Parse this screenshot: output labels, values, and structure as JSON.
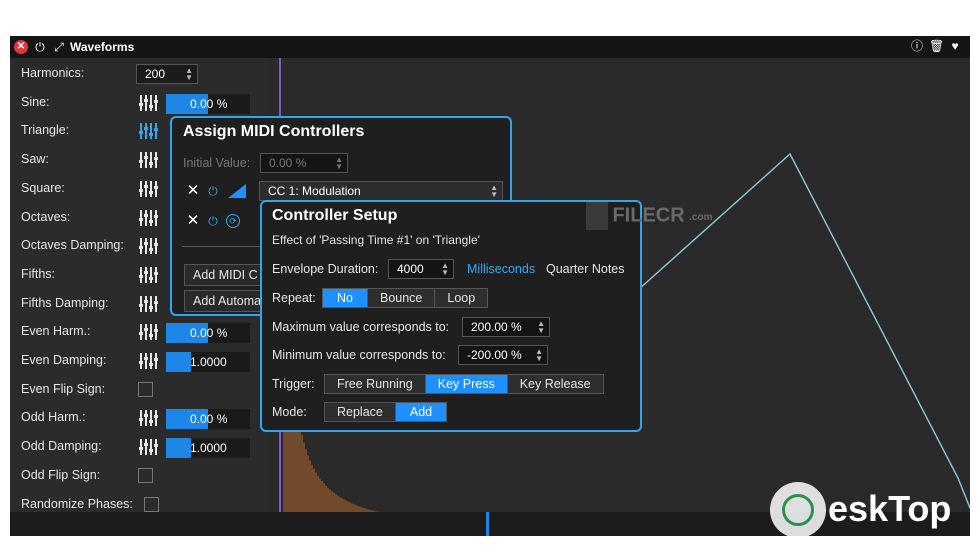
{
  "window": {
    "title": "Waveforms",
    "accent": "#1e86e6",
    "highlight": "#35a5ea"
  },
  "params": [
    {
      "label": "Harmonics:",
      "kind": "number",
      "value": "200"
    },
    {
      "label": "Sine:",
      "kind": "slider",
      "value": "0.00 %",
      "fill": 0.5
    },
    {
      "label": "Triangle:",
      "kind": "slider-active",
      "value": ""
    },
    {
      "label": "Saw:",
      "kind": "slider",
      "value": ""
    },
    {
      "label": "Square:",
      "kind": "slider",
      "value": ""
    },
    {
      "label": "Octaves:",
      "kind": "slider",
      "value": ""
    },
    {
      "label": "Octaves Damping:",
      "kind": "slider",
      "value": ""
    },
    {
      "label": "Fifths:",
      "kind": "slider",
      "value": ""
    },
    {
      "label": "Fifths Damping:",
      "kind": "slider",
      "value": ""
    },
    {
      "label": "Even Harm.:",
      "kind": "slider",
      "value": "0.00 %",
      "fill": 0.5
    },
    {
      "label": "Even Damping:",
      "kind": "slider",
      "value": "1.0000",
      "fill": 0.3
    },
    {
      "label": "Even Flip Sign:",
      "kind": "checkbox",
      "value": ""
    },
    {
      "label": "Odd Harm.:",
      "kind": "slider",
      "value": "0.00 %",
      "fill": 0.5
    },
    {
      "label": "Odd Damping:",
      "kind": "slider",
      "value": "1.0000",
      "fill": 0.3
    },
    {
      "label": "Odd Flip Sign:",
      "kind": "checkbox",
      "value": ""
    },
    {
      "label": "Randomize Phases:",
      "kind": "checkbox-far",
      "value": ""
    }
  ],
  "assign": {
    "title": "Assign MIDI Controllers",
    "initial_label": "Initial Value:",
    "initial_value": "0.00 %",
    "cc_select": "CC 1: Modulation",
    "add_midi": "Add MIDI C",
    "add_automation": "Add Automa"
  },
  "setup": {
    "title": "Controller Setup",
    "subtitle": "Effect of 'Passing Time #1' on 'Triangle'",
    "envelope_label": "Envelope Duration:",
    "envelope_value": "4000",
    "unit_ms": "Milliseconds",
    "unit_notes": "Quarter Notes",
    "repeat_label": "Repeat:",
    "repeat_options": [
      "No",
      "Bounce",
      "Loop"
    ],
    "max_label": "Maximum value corresponds to:",
    "max_value": "200.00 %",
    "min_label": "Minimum value corresponds to:",
    "min_value": "-200.00 %",
    "trigger_label": "Trigger:",
    "trigger_options": [
      "Free Running",
      "Key Press",
      "Key Release"
    ],
    "mode_label": "Mode:",
    "mode_options": [
      "Replace",
      "Add"
    ]
  },
  "watermarks": {
    "filecr": "FILECR",
    "filecr_sub": ".com",
    "desktop": "eskTop"
  }
}
